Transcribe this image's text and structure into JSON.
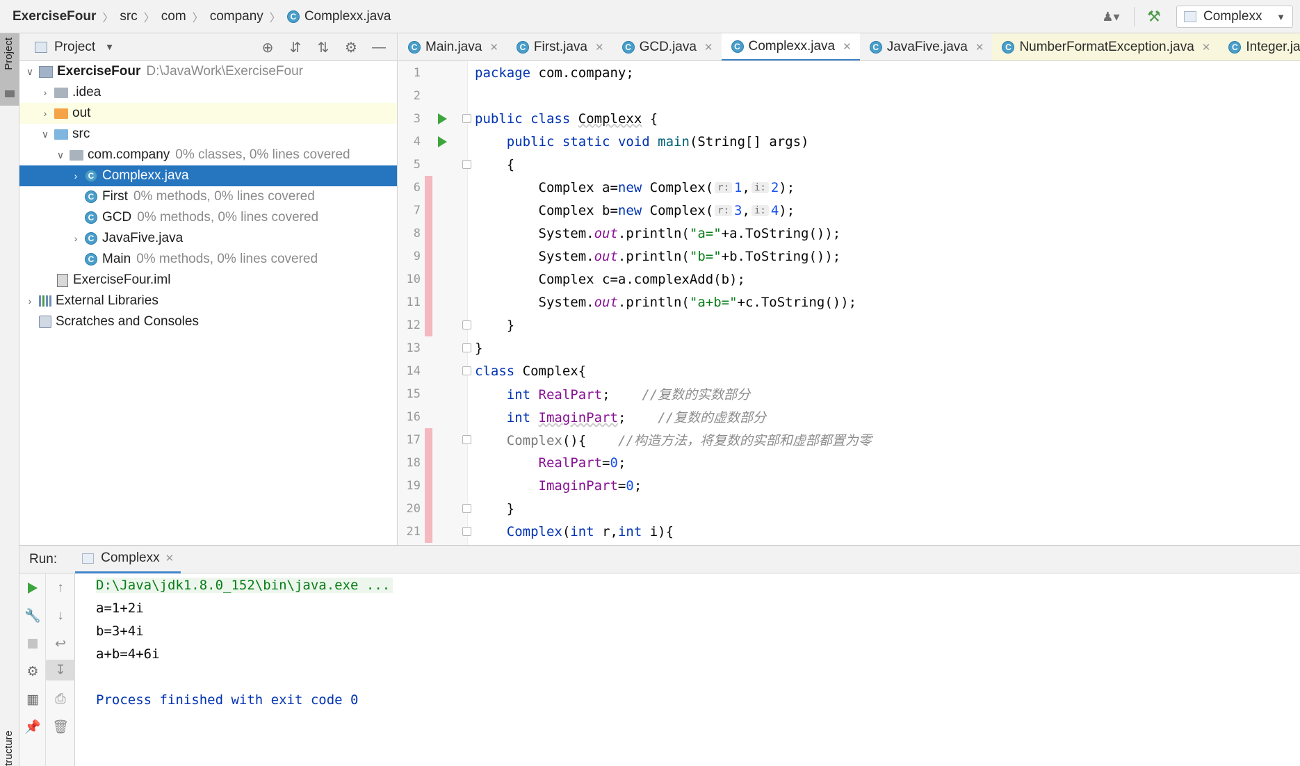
{
  "breadcrumbs": [
    "ExerciseFour",
    "src",
    "com",
    "company",
    "Complexx.java"
  ],
  "run_config": "Complexx",
  "left_stripe": {
    "project_tab": "Project",
    "structure_tab": "tructure"
  },
  "project_panel": {
    "title": "Project",
    "tree": [
      {
        "label": "ExerciseFour",
        "path": "D:\\JavaWork\\ExerciseFour"
      },
      {
        "label": ".idea"
      },
      {
        "label": "out"
      },
      {
        "label": "src"
      },
      {
        "label": "com.company",
        "coverage": "0% classes, 0% lines covered"
      },
      {
        "label": "Complexx.java"
      },
      {
        "label": "First",
        "coverage": "0% methods, 0% lines covered"
      },
      {
        "label": "GCD",
        "coverage": "0% methods, 0% lines covered"
      },
      {
        "label": "JavaFive.java"
      },
      {
        "label": "Main",
        "coverage": "0% methods, 0% lines covered"
      },
      {
        "label": "ExerciseFour.iml"
      },
      {
        "label": "External Libraries"
      },
      {
        "label": "Scratches and Consoles"
      }
    ]
  },
  "editor_tabs": [
    "Main.java",
    "First.java",
    "GCD.java",
    "Complexx.java",
    "JavaFive.java",
    "NumberFormatException.java",
    "Integer.ja"
  ],
  "code": {
    "line_numbers": [
      "1",
      "2",
      "3",
      "4",
      "5",
      "6",
      "7",
      "8",
      "9",
      "10",
      "11",
      "12",
      "13",
      "14",
      "15",
      "16",
      "17",
      "18",
      "19",
      "20",
      "21"
    ],
    "l1": [
      "package",
      "com.company;"
    ],
    "l3": [
      "public",
      "class",
      "Complexx",
      "{"
    ],
    "l4": [
      "public",
      "static",
      "void",
      "main",
      "(String[] args)"
    ],
    "l5": "{",
    "l6": [
      "Complex a=",
      "new",
      " Complex(",
      "r:",
      "1",
      ",",
      "i:",
      "2",
      ");"
    ],
    "l7": [
      "Complex b=",
      "new",
      " Complex(",
      "r:",
      "3",
      ",",
      "i:",
      "4",
      ");"
    ],
    "l8": [
      "System.",
      "out",
      ".println(",
      "\"a=\"",
      "+a.ToString());"
    ],
    "l9": [
      "System.",
      "out",
      ".println(",
      "\"b=\"",
      "+b.ToString());"
    ],
    "l10": "Complex c=a.complexAdd(b);",
    "l11": [
      "System.",
      "out",
      ".println(",
      "\"a+b=\"",
      "+c.ToString());"
    ],
    "l12": "}",
    "l13": "}",
    "l14": [
      "class",
      "Complex{"
    ],
    "l15": [
      "int",
      "RealPart",
      ";",
      "//复数的实数部分"
    ],
    "l16": [
      "int",
      "ImaginPart",
      ";",
      "//复数的虚数部分"
    ],
    "l17": [
      "Complex",
      "(){",
      "//构造方法，将复数的实部和虚部都置为零"
    ],
    "l18": [
      "RealPart",
      "=",
      "0",
      ";"
    ],
    "l19": [
      "ImaginPart",
      "=",
      "0",
      ";"
    ],
    "l20": "}",
    "l21": [
      "Complex",
      "(",
      "int",
      " r,",
      "int",
      " i){"
    ]
  },
  "run_panel": {
    "label": "Run:",
    "tab": "Complexx",
    "console": {
      "cmd": "D:\\Java\\jdk1.8.0_152\\bin\\java.exe ...",
      "out1": "a=1+2i",
      "out2": "b=3+4i",
      "out3": "a+b=4+6i",
      "exit": "Process finished with exit code 0"
    }
  },
  "colors": {
    "selection": "#2675bf",
    "keyword": "#0033b3",
    "string": "#067d17",
    "run_green": "#3da53d",
    "coverage_red": "#f5b8bf"
  }
}
